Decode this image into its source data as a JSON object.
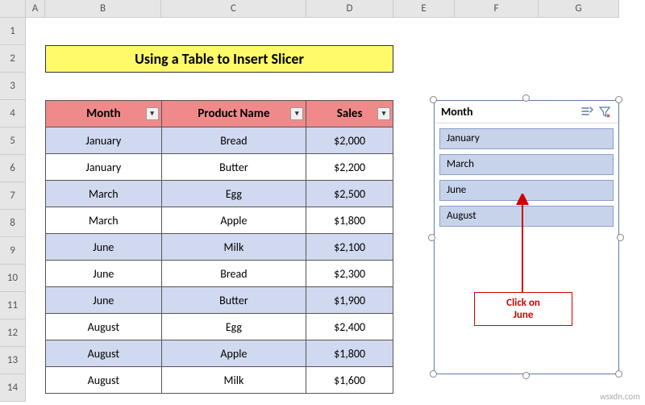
{
  "columns": [
    "A",
    "B",
    "C",
    "D",
    "E",
    "F",
    "G"
  ],
  "rows": [
    "1",
    "2",
    "3",
    "4",
    "5",
    "6",
    "7",
    "8",
    "9",
    "10",
    "11",
    "12",
    "13",
    "14"
  ],
  "title": "Using a Table to Insert Slicer",
  "table": {
    "headers": {
      "month": "Month",
      "product": "Product Name",
      "sales": "Sales"
    },
    "rows": [
      {
        "month": "January",
        "product": "Bread",
        "sales": "$2,000"
      },
      {
        "month": "January",
        "product": "Butter",
        "sales": "$2,200"
      },
      {
        "month": "March",
        "product": "Egg",
        "sales": "$2,500"
      },
      {
        "month": "March",
        "product": "Apple",
        "sales": "$1,800"
      },
      {
        "month": "June",
        "product": "Milk",
        "sales": "$2,100"
      },
      {
        "month": "June",
        "product": "Bread",
        "sales": "$2,300"
      },
      {
        "month": "June",
        "product": "Butter",
        "sales": "$1,900"
      },
      {
        "month": "August",
        "product": "Egg",
        "sales": "$2,400"
      },
      {
        "month": "August",
        "product": "Apple",
        "sales": "$1,800"
      },
      {
        "month": "August",
        "product": "Milk",
        "sales": "$1,600"
      }
    ]
  },
  "slicer": {
    "title": "Month",
    "items": [
      "January",
      "March",
      "June",
      "August"
    ]
  },
  "callout": "Click on\nJune",
  "watermark": "wsxdn.com",
  "chart_data": {
    "type": "table",
    "columns": [
      "Month",
      "Product Name",
      "Sales"
    ],
    "records": [
      [
        "January",
        "Bread",
        2000
      ],
      [
        "January",
        "Butter",
        2200
      ],
      [
        "March",
        "Egg",
        2500
      ],
      [
        "March",
        "Apple",
        1800
      ],
      [
        "June",
        "Milk",
        2100
      ],
      [
        "June",
        "Bread",
        2300
      ],
      [
        "June",
        "Butter",
        1900
      ],
      [
        "August",
        "Egg",
        2400
      ],
      [
        "August",
        "Apple",
        1800
      ],
      [
        "August",
        "Milk",
        1600
      ]
    ]
  }
}
